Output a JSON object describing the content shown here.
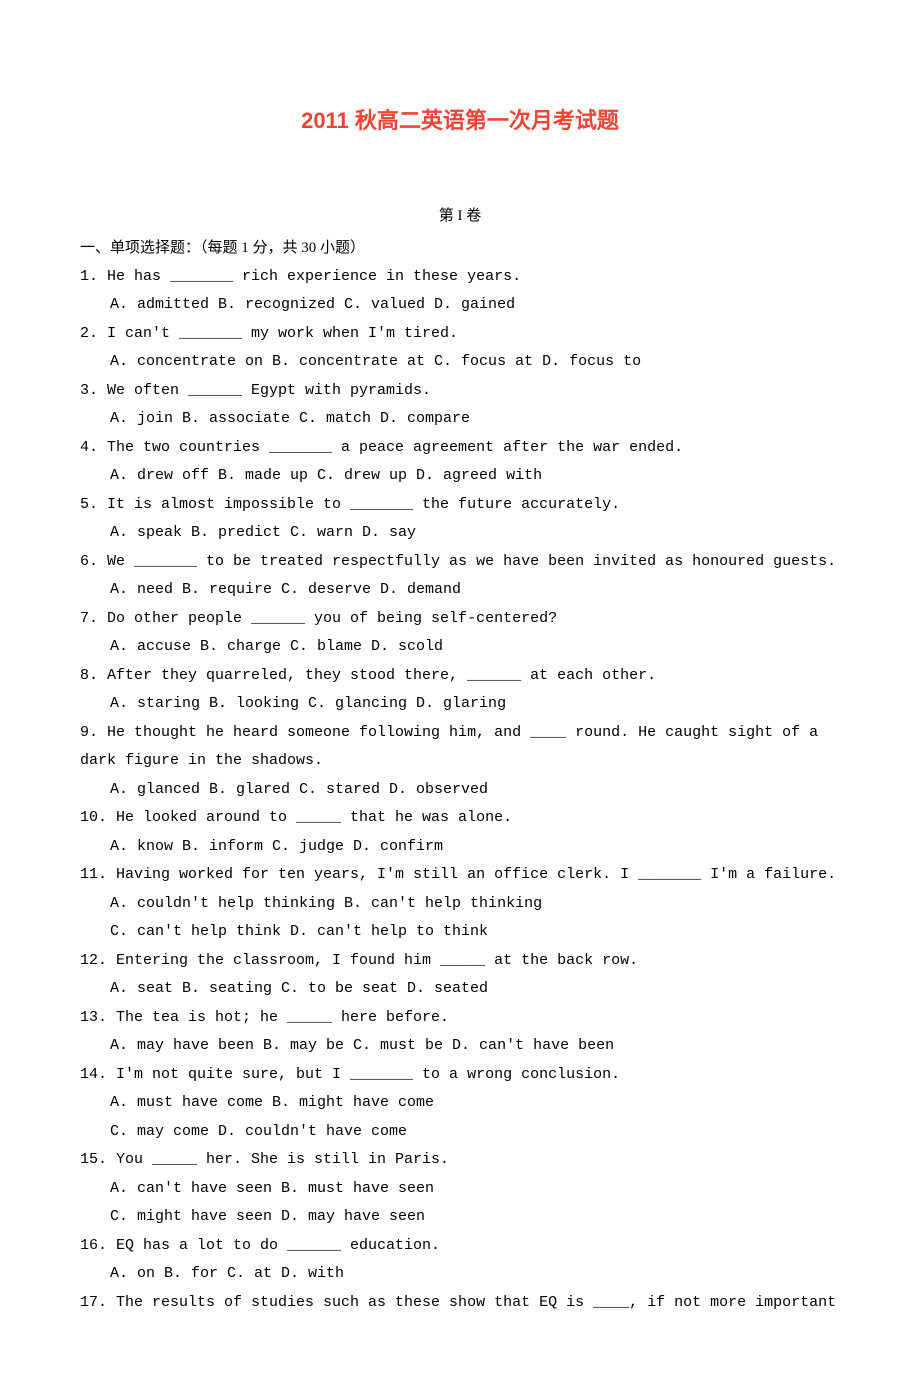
{
  "title": "2011 秋高二英语第一次月考试题",
  "section_header": "第 I 卷",
  "instructions": "一、单项选择题：（每题 1 分，共 30 小题）",
  "questions": [
    {
      "stem": "1. He has _______ rich experience in these years.",
      "options": [
        "A. admitted    B. recognized    C. valued  D. gained"
      ]
    },
    {
      "stem": "2. I can't _______ my work when I'm tired.",
      "options": [
        "A. concentrate on   B. concentrate at    C. focus at   D. focus to"
      ]
    },
    {
      "stem": "3. We often ______ Egypt with pyramids.",
      "options": [
        "A. join    B. associate    C. match   D. compare"
      ]
    },
    {
      "stem": "4. The two countries _______ a peace agreement after the war ended.",
      "options": [
        "A. drew off    B. made up    C. drew up   D. agreed with"
      ]
    },
    {
      "stem": "5. It is almost impossible to _______ the future accurately.",
      "options": [
        "A. speak    B. predict    C. warn    D. say"
      ]
    },
    {
      "stem": "6. We _______ to be treated respectfully as we have been invited as honoured guests.",
      "options": [
        "A. need    B. require    C. deserve    D. demand"
      ]
    },
    {
      "stem": "7. Do other people ______ you of being self-centered?",
      "options": [
        "A. accuse    B. charge    C. blame     D. scold"
      ]
    },
    {
      "stem": "8. After they quarreled, they stood there, ______ at each other.",
      "options": [
        "A. staring    B. looking    C. glancing   D. glaring"
      ]
    },
    {
      "stem": "9. He thought he heard someone following him, and ____ round. He caught sight of a dark figure in the shadows.",
      "options": [
        "A. glanced    B. glared    C. stared   D. observed"
      ]
    },
    {
      "stem": "10. He looked around to _____ that he was alone.",
      "options": [
        "A. know    B. inform    C. judge   D. confirm"
      ]
    },
    {
      "stem": "11. Having worked for ten years, I'm still an office clerk. I _______ I'm a failure.",
      "options": [
        "A. couldn't help thinking     B. can't help thinking",
        "C. can't help think           D. can't help to think"
      ]
    },
    {
      "stem": "12. Entering the classroom, I found him _____ at the back row.",
      "options": [
        "A. seat    B. seating    C. to be seat    D. seated"
      ]
    },
    {
      "stem": "13. The tea is hot; he _____ here before.",
      "options": [
        "A. may have been   B. may be    C. must be    D. can't have been"
      ]
    },
    {
      "stem": "14. I'm not quite sure, but I _______ to a wrong conclusion.",
      "options": [
        "A. must have come      B. might have come",
        "C. may come            D. couldn't have come"
      ]
    },
    {
      "stem": "15. You _____ her. She is still in Paris.",
      "options": [
        "A. can't have seen        B. must have seen",
        "C. might have seen      D. may have seen"
      ]
    },
    {
      "stem": "16. EQ has a lot to do ______ education.",
      "options": [
        "A. on    B. for    C. at     D. with"
      ]
    },
    {
      "stem": "17. The results of studies such as these show that EQ is ____, if not more important",
      "options": []
    }
  ]
}
